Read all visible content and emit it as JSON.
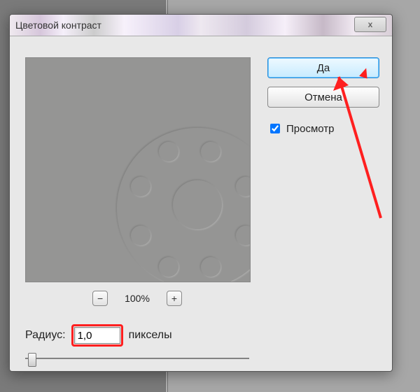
{
  "dialog": {
    "title": "Цветовой контраст",
    "close_icon": "x"
  },
  "zoom": {
    "out": "−",
    "value": "100%",
    "in": "+"
  },
  "radius": {
    "label": "Радиус:",
    "value": "1,0",
    "unit": "пикселы"
  },
  "buttons": {
    "ok": "Да",
    "cancel": "Отмена"
  },
  "preview": {
    "label": "Просмотр",
    "checked": true
  }
}
